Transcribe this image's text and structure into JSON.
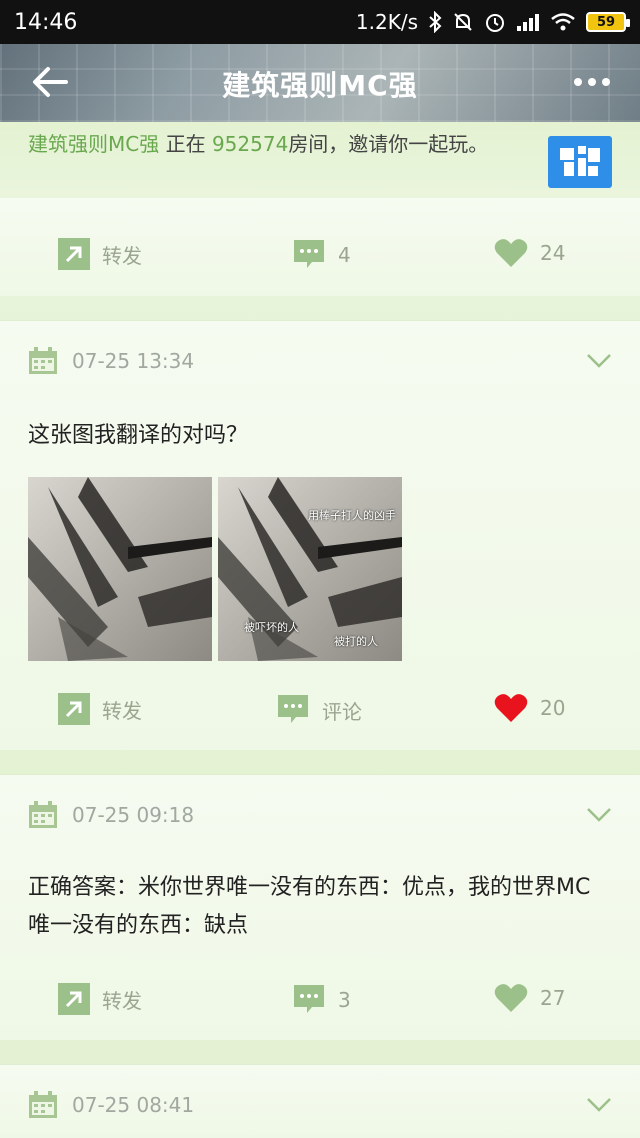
{
  "status_bar": {
    "time": "14:46",
    "network_speed": "1.2K/s",
    "battery": "59"
  },
  "header": {
    "title": "建筑强则MC强"
  },
  "invite": {
    "user": "建筑强则MC强",
    "text_mid": " 正在 ",
    "room": "952574",
    "text_end": "房间，邀请你一起玩。"
  },
  "post0": {
    "forward_label": "转发",
    "comment_count": "4",
    "like_count": "24"
  },
  "post1": {
    "date": "07-25 13:34",
    "text": "这张图我翻译的对吗？",
    "image2_captions": [
      "用棒子打人的凶手",
      "被吓坏的人",
      "被打的人"
    ],
    "forward_label": "转发",
    "comment_label": "评论",
    "like_count": "20",
    "liked": true
  },
  "post2": {
    "date": "07-25 09:18",
    "text": "正确答案：米你世界唯一没有的东西：优点，我的世界MC唯一没有的东西：缺点",
    "forward_label": "转发",
    "comment_count": "3",
    "like_count": "27"
  },
  "post3": {
    "date": "07-25 08:41"
  },
  "colors": {
    "accent_green": "#6aa84f",
    "icon_green": "#9cc08a",
    "liked_red": "#e8131c"
  }
}
